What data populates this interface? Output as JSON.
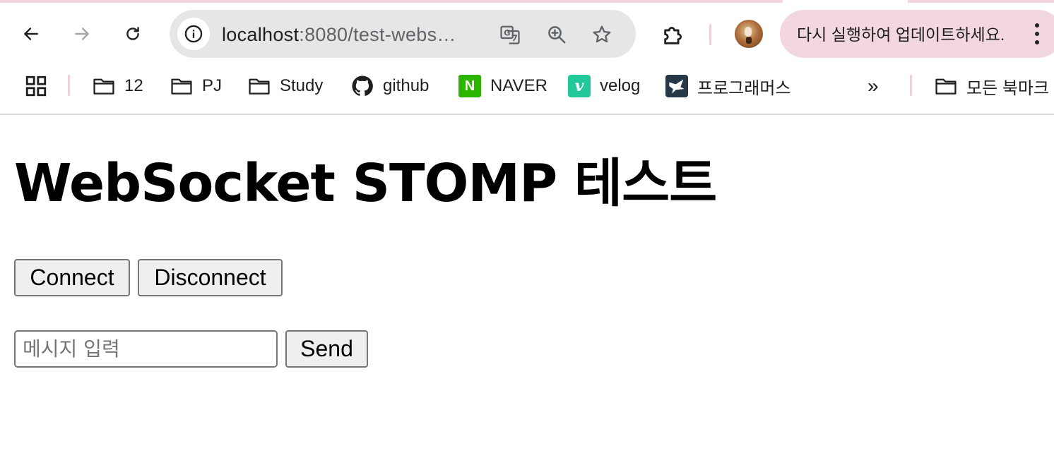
{
  "browser": {
    "url_host": "localhost",
    "url_rest": ":8080/test-webs…",
    "update_notice": "다시 실행하여 업데이트하세요.",
    "accent_color": "#f2d7e3",
    "icons": {
      "back": "arrow-left-icon",
      "forward": "arrow-right-icon",
      "reload": "reload-icon",
      "site_info": "info-icon",
      "translate": "translate-icon",
      "zoom": "zoom-icon",
      "bookmark_star": "star-icon",
      "extensions": "puzzle-icon",
      "menu": "kebab-menu-icon"
    }
  },
  "bookmarks": {
    "items": [
      {
        "label": "12",
        "icon": "folder-icon"
      },
      {
        "label": "PJ",
        "icon": "folder-icon"
      },
      {
        "label": "Study",
        "icon": "folder-icon"
      },
      {
        "label": "github",
        "icon": "github-icon"
      },
      {
        "label": "NAVER",
        "icon": "naver-icon",
        "icon_text": "N"
      },
      {
        "label": "velog",
        "icon": "velog-icon",
        "icon_text": "v"
      },
      {
        "label": "프로그래머스",
        "icon": "programmers-icon"
      }
    ],
    "overflow_label": "»",
    "all_bookmarks": "모든 북마크"
  },
  "page": {
    "title": "WebSocket STOMP 테스트",
    "connect_label": "Connect",
    "disconnect_label": "Disconnect",
    "message_placeholder": "메시지 입력",
    "message_value": "",
    "send_label": "Send"
  }
}
